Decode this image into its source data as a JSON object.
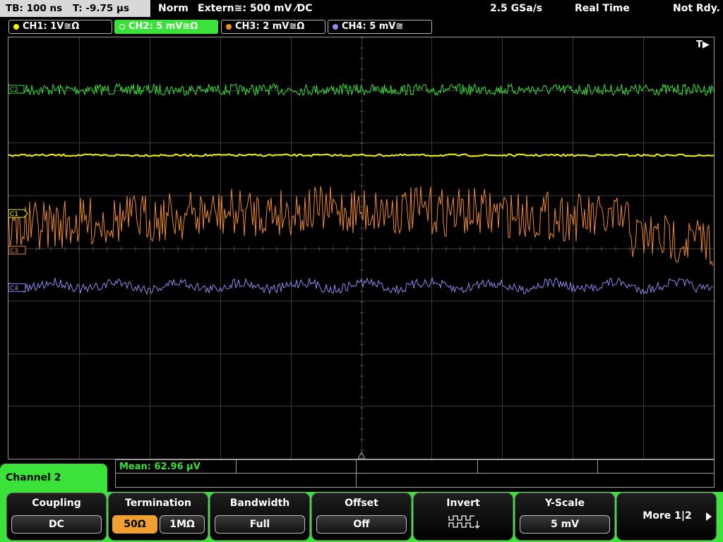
{
  "topbar": {
    "tb": "TB: 100 ns",
    "t": "T: -9.75 µs",
    "mode": "Norm",
    "trigger": "Extern≅: 500 mV ⁄DC",
    "sample_rate": "2.5 GSa/s",
    "acq": "Real Time",
    "status": "Not Rdy."
  },
  "channels": [
    {
      "label": "CH1: 1V≅Ω",
      "color": "#f5f500"
    },
    {
      "label": "CH2: 5 mV≅Ω",
      "color": "#3ae23a"
    },
    {
      "label": "CH3: 2 mV≅Ω",
      "color": "#f08a2c"
    },
    {
      "label": "CH4: 5 mV≅",
      "color": "#8c8cf0"
    }
  ],
  "markers": {
    "trigger": "T▶",
    "c1": "C1",
    "c2": "C2",
    "c3": "C3",
    "c4": "C4"
  },
  "measure": {
    "mean": "Mean: 62.96 µV"
  },
  "menu": {
    "tab": "Channel 2",
    "coupling": {
      "label": "Coupling",
      "value": "DC"
    },
    "termination": {
      "label": "Termination",
      "opt1": "50Ω",
      "opt2": "1MΩ"
    },
    "bandwidth": {
      "label": "Bandwidth",
      "value": "Full"
    },
    "offset": {
      "label": "Offset",
      "value": "Off"
    },
    "invert": {
      "label": "Invert"
    },
    "yscale": {
      "label": "Y-Scale",
      "value": "5 mV"
    },
    "more": {
      "label": "More 1|2"
    }
  },
  "colors": {
    "accent": "#3ae23a",
    "selected": "#f0a030"
  }
}
